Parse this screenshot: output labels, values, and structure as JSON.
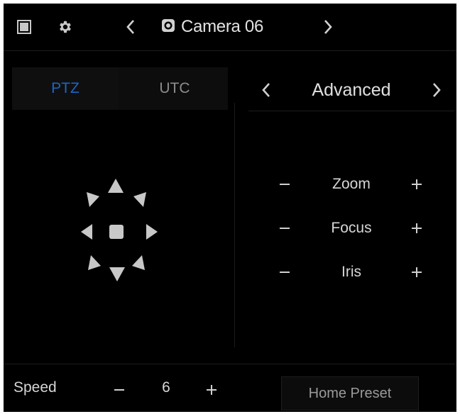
{
  "header": {
    "camera_name": "Camera 06"
  },
  "tabs": [
    {
      "label": "PTZ",
      "active": true
    },
    {
      "label": "UTC",
      "active": false
    }
  ],
  "advanced": {
    "title": "Advanced",
    "controls": [
      {
        "label": "Zoom"
      },
      {
        "label": "Focus"
      },
      {
        "label": "Iris"
      }
    ]
  },
  "bottom": {
    "speed_label": "Speed",
    "speed_value": "6",
    "home_preset_label": "Home Preset"
  },
  "colors": {
    "background": "#000000",
    "active_tab": "#1f64c4",
    "text": "#d6d6d6",
    "icon": "#c8c8c8"
  }
}
